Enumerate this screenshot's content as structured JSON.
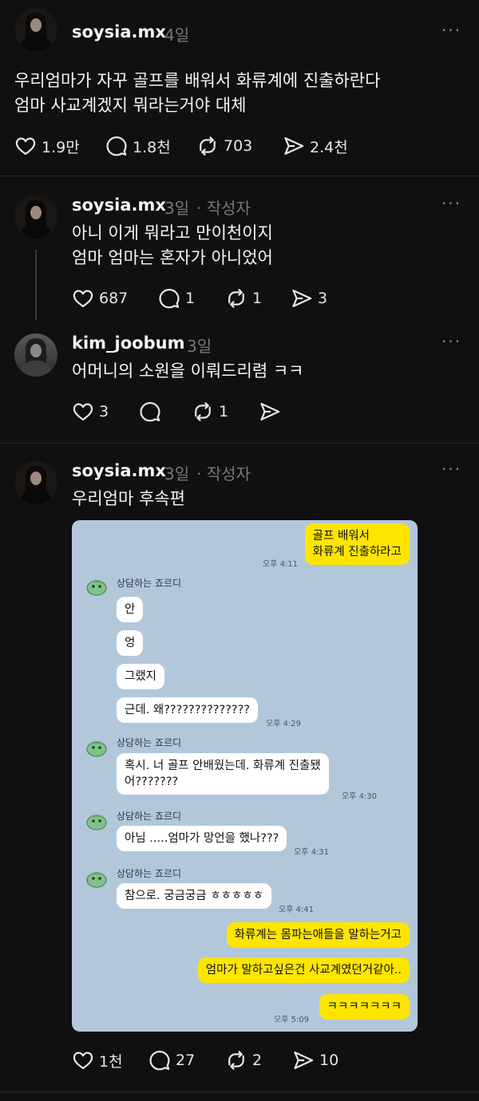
{
  "posts": [
    {
      "username": "soysia.mx",
      "time": "4일",
      "more": "···",
      "lines": [
        "우리엄마가 자꾸 골프를 배워서 화류계에 진출하란다",
        "엄마 사교계겠지 뭐라는거야 대체"
      ],
      "likes": "1.9만",
      "replies": "1.8천",
      "reposts": "703",
      "shares": "2.4천"
    },
    {
      "username": "soysia.mx",
      "time": "3일",
      "author_tag": "· 작성자",
      "more": "···",
      "lines": [
        "아니 이게 뭐라고 만이천이지",
        "엄마 엄마는 혼자가 아니었어"
      ],
      "likes": "687",
      "replies": "1",
      "reposts": "1",
      "shares": "3"
    },
    {
      "username": "kim_joobum",
      "time": "3일",
      "more": "···",
      "lines": [
        "어머니의 소원을 이뤄드리렴 ㅋㅋ"
      ],
      "likes": "3",
      "replies": "",
      "reposts": "1",
      "shares": ""
    },
    {
      "username": "soysia.mx",
      "time": "3일",
      "author_tag": "· 작성자",
      "more": "···",
      "lines": [
        "우리엄마 후속편"
      ],
      "likes": "1천",
      "replies": "27",
      "reposts": "2",
      "shares": "10"
    }
  ],
  "chat": {
    "contact_name": "상담하는 죠르디",
    "messages": [
      {
        "side": "me",
        "lines": [
          "골프 배워서",
          "화류계 진출하라고"
        ],
        "time": "오후 4:11"
      },
      {
        "side": "them",
        "lines": [
          "안"
        ]
      },
      {
        "side": "them",
        "lines": [
          "엉"
        ]
      },
      {
        "side": "them",
        "lines": [
          "그랬지"
        ]
      },
      {
        "side": "them",
        "lines": [
          "근데. 왜??????????????"
        ],
        "time": "오후 4:29"
      },
      {
        "side": "them",
        "lines": [
          "혹시.  너 골프 안배웠는데. 화류계 진출됐",
          "어???????"
        ],
        "time": "오후 4:30"
      },
      {
        "side": "them",
        "lines": [
          "아님 .....엄마가 망언을 했나???"
        ],
        "time": "오후 4:31"
      },
      {
        "side": "them",
        "lines": [
          "참으로. 궁금궁금 ㅎㅎㅎㅎㅎ"
        ],
        "time": "오후 4:41"
      },
      {
        "side": "me",
        "lines": [
          "화류계는 몸파는애들을 말하는거고"
        ]
      },
      {
        "side": "me",
        "lines": [
          "엄마가 말하고싶은건 사교계였던거같아.."
        ]
      },
      {
        "side": "me",
        "lines": [
          "ㅋㅋㅋㅋㅋㅋㅋ"
        ],
        "time": "오후 5:09"
      }
    ]
  },
  "icons": {
    "like": "heart-icon",
    "reply": "speech-bubble-icon",
    "repost": "repost-icon",
    "share": "send-icon",
    "more": "more-dots-icon"
  },
  "colors": {
    "background": "#101010",
    "chat_background": "#b2c7da",
    "my_bubble": "#fee500",
    "their_bubble": "#ffffff"
  }
}
